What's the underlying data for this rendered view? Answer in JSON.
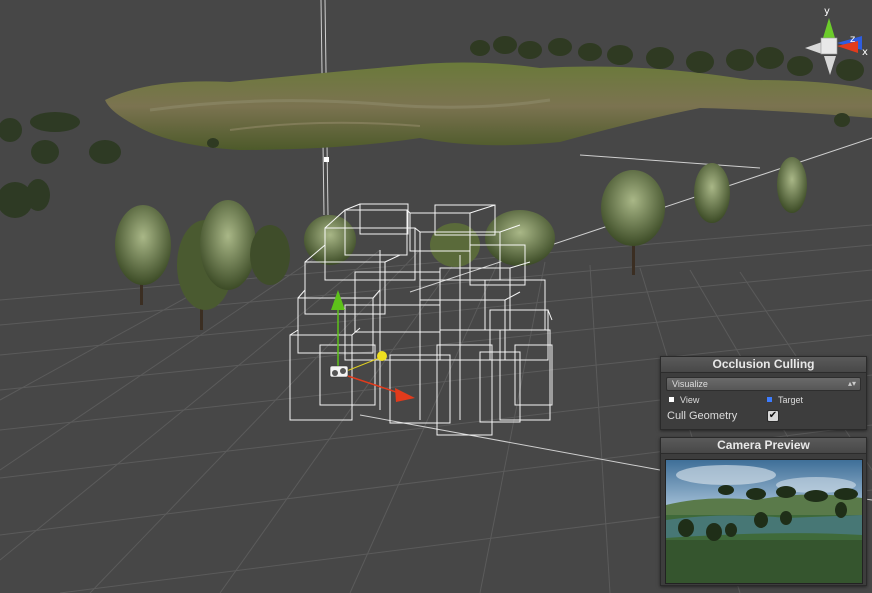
{
  "axis_gizmo": {
    "y_label": "y",
    "z_label": "z",
    "x_label": "x"
  },
  "occlusion_panel": {
    "title": "Occlusion Culling",
    "mode_value": "Visualize",
    "legend_view": "View",
    "legend_target": "Target",
    "cull_geometry_label": "Cull Geometry",
    "cull_geometry_checked": true,
    "view_color": "#ffffff",
    "target_color": "#3d7cff"
  },
  "camera_panel": {
    "title": "Camera Preview"
  },
  "colors": {
    "background": "#474747",
    "grid": "#5a5a5a",
    "occlusion_cells": "#ffffff",
    "y_axis": "#5ec21a",
    "x_axis": "#e23b1c",
    "z_axis": "#2f5de0"
  }
}
